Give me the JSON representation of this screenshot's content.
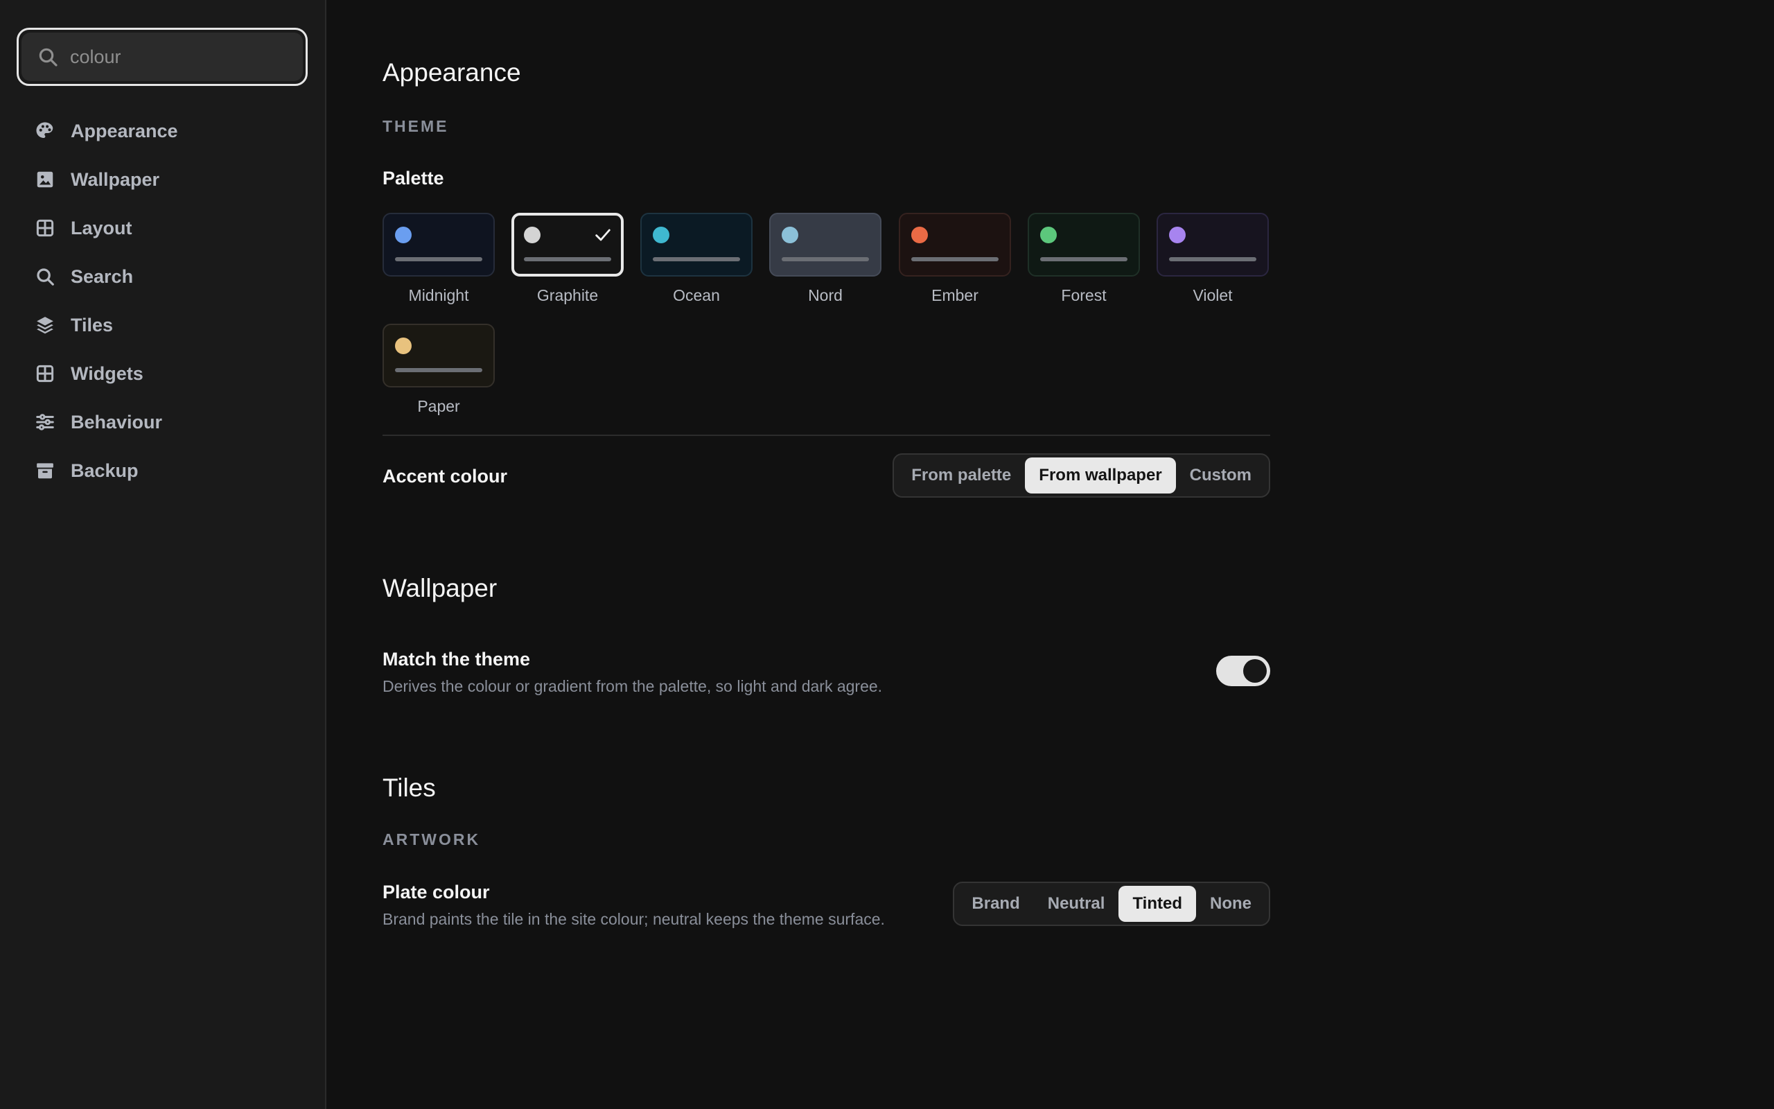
{
  "search": {
    "placeholder": "colour"
  },
  "sidebar": {
    "items": [
      {
        "label": "Appearance",
        "icon": "palette-icon"
      },
      {
        "label": "Wallpaper",
        "icon": "image-icon"
      },
      {
        "label": "Layout",
        "icon": "grid-icon"
      },
      {
        "label": "Search",
        "icon": "search-icon"
      },
      {
        "label": "Tiles",
        "icon": "layers-icon"
      },
      {
        "label": "Widgets",
        "icon": "widgets-icon"
      },
      {
        "label": "Behaviour",
        "icon": "sliders-icon"
      },
      {
        "label": "Backup",
        "icon": "archive-icon"
      }
    ]
  },
  "appearance": {
    "title": "Appearance",
    "theme_label": "THEME",
    "palette_label": "Palette",
    "selected_palette": "Graphite",
    "palettes": [
      {
        "name": "Midnight",
        "dot": "#6a9ef0",
        "bg": "#0f1420",
        "border": "#262c3a"
      },
      {
        "name": "Graphite",
        "dot": "#d4d4d4",
        "bg": "#141414",
        "border": "#e8e8e8"
      },
      {
        "name": "Ocean",
        "dot": "#3fb8d0",
        "bg": "#0b1a24",
        "border": "#1d3340"
      },
      {
        "name": "Nord",
        "dot": "#8cc0d8",
        "bg": "#363b46",
        "border": "#454b58"
      },
      {
        "name": "Ember",
        "dot": "#ea6a45",
        "bg": "#1c1211",
        "border": "#35221f"
      },
      {
        "name": "Forest",
        "dot": "#5cc77c",
        "bg": "#0f1914",
        "border": "#1f3027"
      },
      {
        "name": "Violet",
        "dot": "#a784ef",
        "bg": "#17141f",
        "border": "#2b2640"
      },
      {
        "name": "Paper",
        "dot": "#e8c27e",
        "bg": "#1a1812",
        "border": "#34302a"
      }
    ],
    "accent": {
      "label": "Accent colour",
      "options": [
        "From palette",
        "From wallpaper",
        "Custom"
      ],
      "selected": "From wallpaper"
    }
  },
  "wallpaper": {
    "title": "Wallpaper",
    "match": {
      "label": "Match the theme",
      "description": "Derives the colour or gradient from the palette, so light and dark agree.",
      "enabled": true
    }
  },
  "tiles": {
    "title": "Tiles",
    "artwork_label": "ARTWORK",
    "plate": {
      "label": "Plate colour",
      "description": "Brand paints the tile in the site colour; neutral keeps the theme surface.",
      "options": [
        "Brand",
        "Neutral",
        "Tinted",
        "None"
      ],
      "selected": "Tinted"
    }
  }
}
